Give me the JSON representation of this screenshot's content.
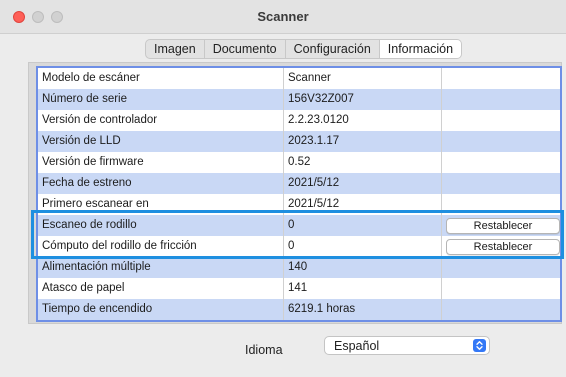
{
  "window": {
    "title": "Scanner"
  },
  "tabs": [
    {
      "label": "Imagen",
      "active": false
    },
    {
      "label": "Documento",
      "active": false
    },
    {
      "label": "Configuración",
      "active": false
    },
    {
      "label": "Información",
      "active": true
    }
  ],
  "info_table": {
    "rows": [
      {
        "label": "Modelo de escáner",
        "value": "Scanner"
      },
      {
        "label": "Número de serie",
        "value": "156V32Z007"
      },
      {
        "label": "Versión de controlador",
        "value": "2.2.23.0120"
      },
      {
        "label": "Versión de LLD",
        "value": "2023.1.17"
      },
      {
        "label": "Versión de firmware",
        "value": "0.52"
      },
      {
        "label": "Fecha de estreno",
        "value": "2021/5/12"
      },
      {
        "label": "Primero escanear en",
        "value": "2021/5/12"
      },
      {
        "label": "Escaneo de rodillo",
        "value": "0",
        "action": "Restablecer"
      },
      {
        "label": "Cómputo del rodillo de fricción",
        "value": "0",
        "action": "Restablecer"
      },
      {
        "label": "Alimentación múltiple",
        "value": "140"
      },
      {
        "label": "Atasco de papel",
        "value": "141"
      },
      {
        "label": "Tiempo de encendido",
        "value": "6219.1 horas"
      }
    ]
  },
  "language": {
    "label": "Idioma",
    "selected": "Español"
  },
  "colors": {
    "highlight": "#1e8fe0",
    "row_alt": "#c9d8f5",
    "close_button": "#fe5f57",
    "select_accent": "#3478f6"
  }
}
